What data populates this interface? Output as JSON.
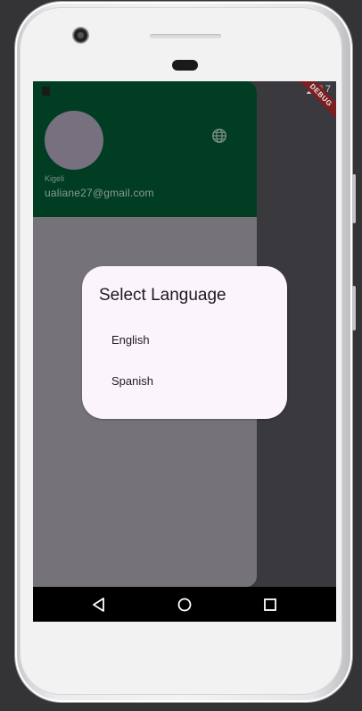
{
  "header": {
    "user_name": "Kigeli",
    "email": "ualiane27@gmail.com"
  },
  "status_bar": {
    "time": "7"
  },
  "debug_banner": {
    "label": "DEBUG"
  },
  "dialog": {
    "title": "Select Language",
    "options": [
      {
        "label": "English"
      },
      {
        "label": "Spanish"
      }
    ]
  },
  "icons": {
    "header_right": "globe-icon",
    "nav": [
      "back-icon",
      "home-icon",
      "recents-icon"
    ]
  },
  "colors": {
    "drawer_header": "#003d22",
    "drawer_body": "#757378",
    "avatar": "#77707f",
    "dialog_bg": "#fcf4fb",
    "debug_banner": "#7a1f22",
    "nav_bar": "#000000"
  }
}
